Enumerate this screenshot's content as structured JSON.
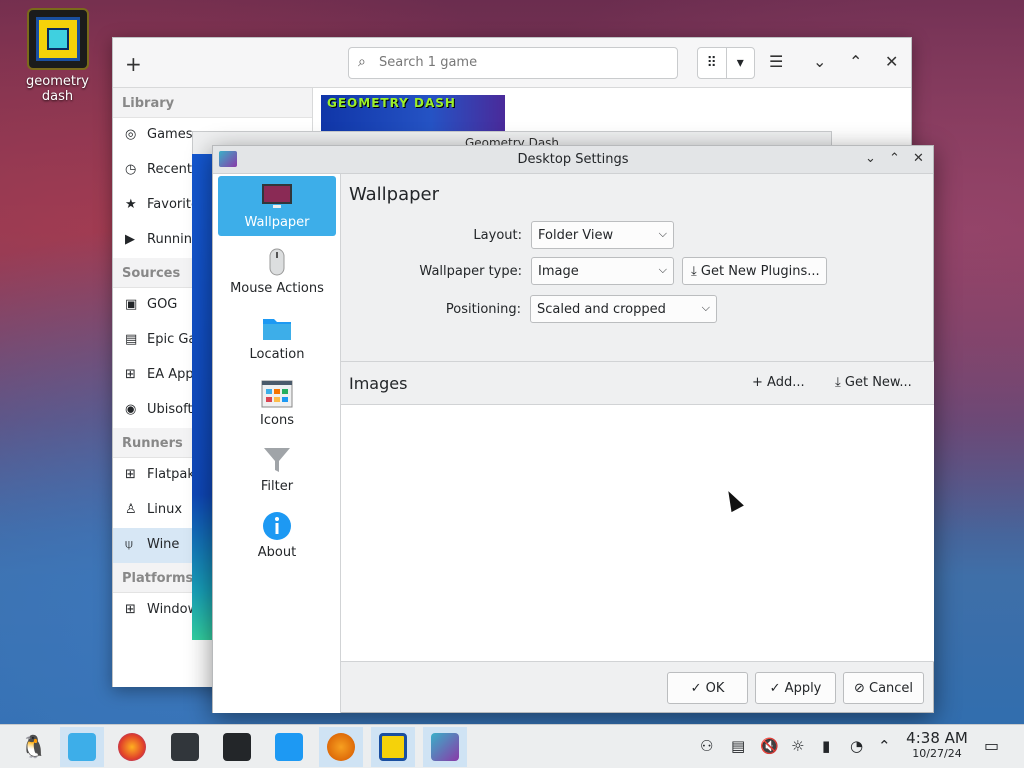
{
  "desktop": {
    "icon_label": "geometry dash"
  },
  "lutris": {
    "search_placeholder": "Search 1 game",
    "sections": {
      "library": "Library",
      "sources": "Sources",
      "runners": "Runners",
      "platforms": "Platforms"
    },
    "library_items": [
      "Games",
      "Recent",
      "Favorites",
      "Running"
    ],
    "source_items": [
      "GOG",
      "Epic Games",
      "EA App",
      "Ubisoft"
    ],
    "runner_items": [
      "Flatpak",
      "Linux",
      "Wine"
    ],
    "platform_items": [
      "Windows"
    ],
    "banner_text": "GEOMETRY DASH"
  },
  "game_window": {
    "title": "Geometry Dash"
  },
  "dialog": {
    "title": "Desktop Settings",
    "nav": [
      "Wallpaper",
      "Mouse Actions",
      "Location",
      "Icons",
      "Filter",
      "About"
    ],
    "heading": "Wallpaper",
    "layout_label": "Layout:",
    "layout_value": "Folder View",
    "wallpaper_type_label": "Wallpaper type:",
    "wallpaper_type_value": "Image",
    "get_plugins": "Get New Plugins...",
    "positioning_label": "Positioning:",
    "positioning_value": "Scaled and cropped",
    "images_heading": "Images",
    "add": "Add...",
    "get_new": "Get New...",
    "ok": "OK",
    "apply": "Apply",
    "cancel": "Cancel"
  },
  "taskbar": {
    "time": "4:38 AM",
    "date": "10/27/24"
  },
  "colors": {
    "accent": "#3daee9",
    "selection": "#d7e7f5"
  }
}
